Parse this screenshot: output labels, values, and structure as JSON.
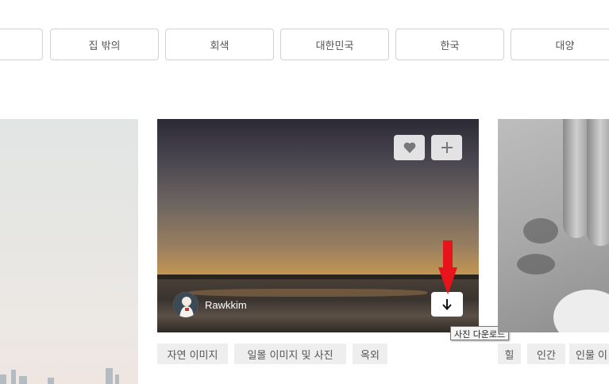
{
  "related_tags": [
    "",
    "집 밖의",
    "회색",
    "대한민국",
    "한국",
    "대양"
  ],
  "main_card": {
    "author": "Rawkkim",
    "download_tooltip": "사진 다운로드",
    "tags": [
      "자연 이미지",
      "일몰 이미지 및 사진",
      "옥외"
    ]
  },
  "right_card": {
    "tags": [
      "힐",
      "인간",
      "인물 이"
    ]
  },
  "icons": [
    "heart-icon",
    "plus-icon",
    "arrow-down-icon",
    "red-arrow-annotation"
  ],
  "colors": {
    "annotation_red": "#e8141c",
    "chip_border": "#d1d1d1",
    "tag_bg": "#eeeeee"
  }
}
